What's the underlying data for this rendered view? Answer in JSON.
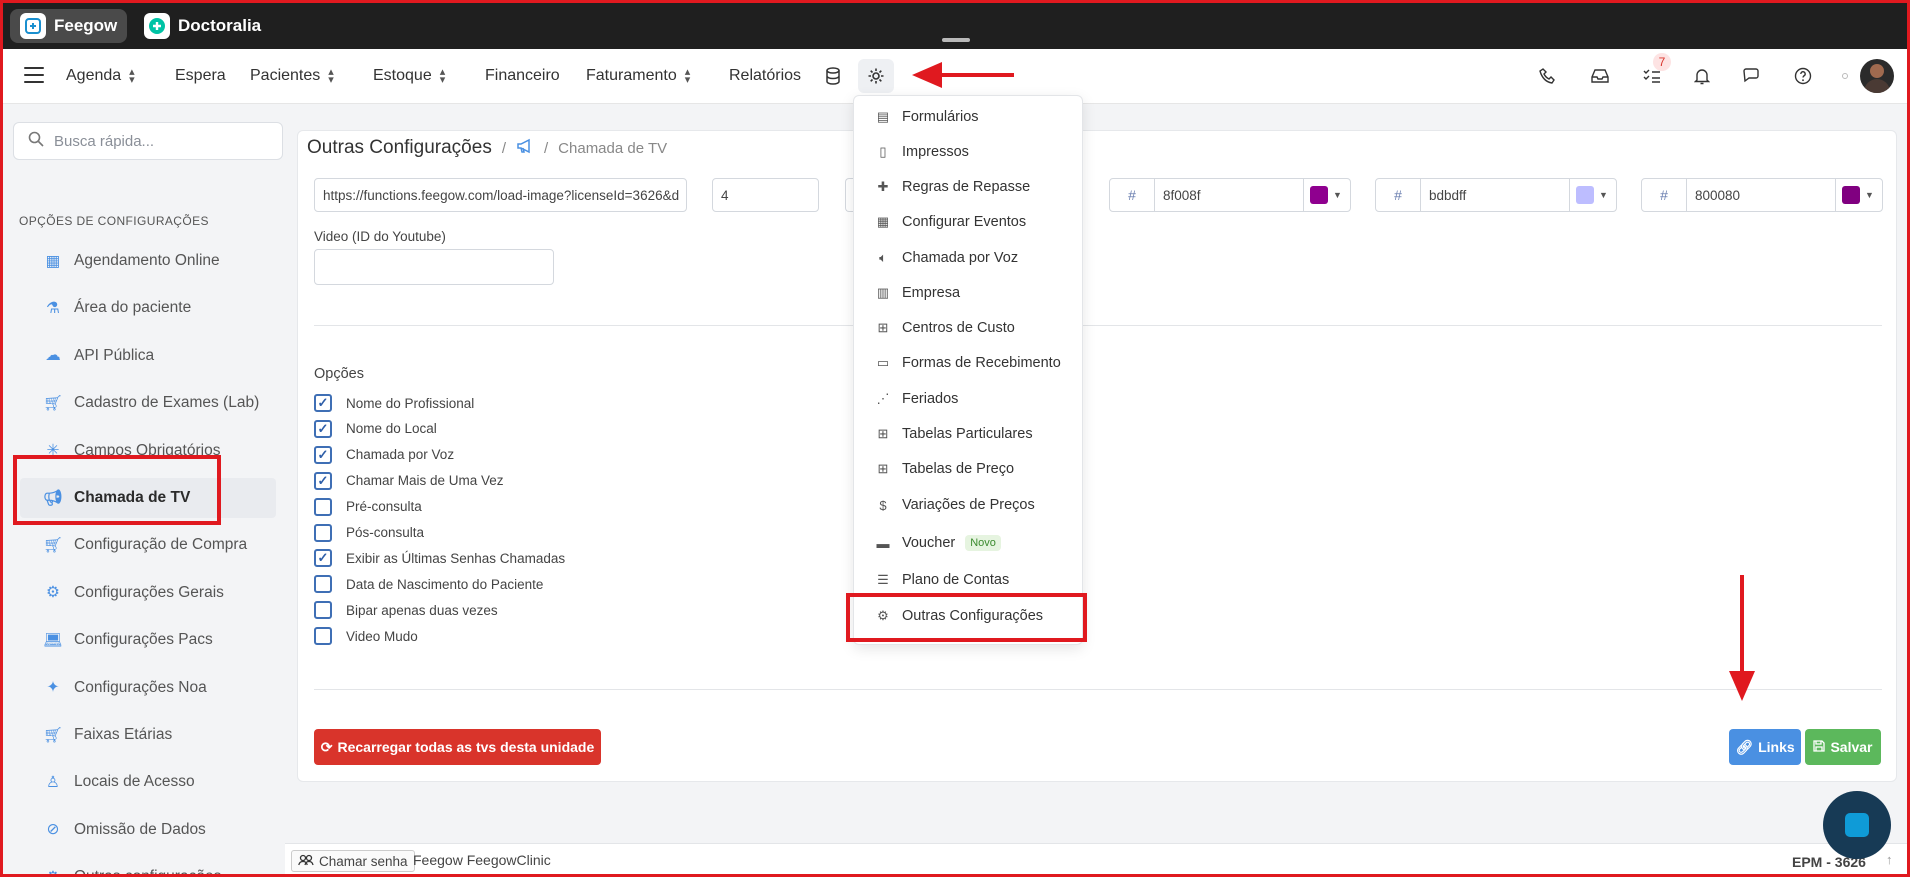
{
  "app_tabs": [
    {
      "label": "Feegow",
      "active": true
    },
    {
      "label": "Doctoralia",
      "active": false
    }
  ],
  "nav": {
    "items": [
      {
        "label": "Agenda"
      },
      {
        "label": "Espera"
      },
      {
        "label": "Pacientes"
      },
      {
        "label": "Estoque"
      },
      {
        "label": "Financeiro"
      },
      {
        "label": "Faturamento"
      },
      {
        "label": "Relatórios"
      }
    ],
    "tasks_badge": "7"
  },
  "sidebar": {
    "search_placeholder": "Busca rápida...",
    "section_title": "OPÇÕES DE CONFIGURAÇÕES",
    "items": [
      {
        "label": "Agendamento Online",
        "icon": "calendar-icon"
      },
      {
        "label": "Área do paciente",
        "icon": "flask-icon"
      },
      {
        "label": "API Pública",
        "icon": "cloud-upload-icon"
      },
      {
        "label": "Cadastro de Exames (Lab)",
        "icon": "cart-icon"
      },
      {
        "label": "Campos Obrigatórios",
        "icon": "asterisk-icon"
      },
      {
        "label": "Chamada de TV",
        "icon": "megaphone-icon",
        "active": true
      },
      {
        "label": "Configuração de Compra",
        "icon": "cart-icon"
      },
      {
        "label": "Configurações Gerais",
        "icon": "cogs-icon"
      },
      {
        "label": "Configurações Pacs",
        "icon": "laptop-icon"
      },
      {
        "label": "Configurações Noa",
        "icon": "sparkles-icon"
      },
      {
        "label": "Faixas Etárias",
        "icon": "cart-icon"
      },
      {
        "label": "Locais de Acesso",
        "icon": "user-lock-icon"
      },
      {
        "label": "Omissão de Dados",
        "icon": "eye-slash-icon"
      },
      {
        "label": "Outras configurações",
        "icon": "cogs-icon"
      }
    ]
  },
  "breadcrumb": {
    "title": "Outras Configurações",
    "separator": "/",
    "current": "Chamada de TV"
  },
  "form": {
    "image_url": "https://functions.feegow.com/load-image?licenseId=3626&d",
    "number_value": "4",
    "color1": "8f008f",
    "color2": "bdbdff",
    "color3": "800080",
    "hash_symbol": "#",
    "video_label": "Video (ID do Youtube)",
    "video_value": "",
    "options_label": "Opções",
    "options": [
      {
        "label": "Nome do Profissional",
        "checked": true
      },
      {
        "label": "Nome do Local",
        "checked": true
      },
      {
        "label": "Chamada por Voz",
        "checked": true
      },
      {
        "label": "Chamar Mais de Uma Vez",
        "checked": true
      },
      {
        "label": "Pré-consulta",
        "checked": false
      },
      {
        "label": "Pós-consulta",
        "checked": false
      },
      {
        "label": "Exibir as Últimas Senhas Chamadas",
        "checked": true
      },
      {
        "label": "Data de Nascimento do Paciente",
        "checked": false
      },
      {
        "label": "Bipar apenas duas vezes",
        "checked": false
      },
      {
        "label": "Video Mudo",
        "checked": false
      }
    ],
    "reload_button": "Recarregar todas as tvs desta unidade",
    "links_button": "Links",
    "save_button": "Salvar"
  },
  "settings_menu": {
    "items": [
      {
        "label": "Formulários",
        "icon": "chart-icon"
      },
      {
        "label": "Impressos",
        "icon": "file-icon"
      },
      {
        "label": "Regras de Repasse",
        "icon": "puzzle-icon"
      },
      {
        "label": "Configurar Eventos",
        "icon": "calendar-icon"
      },
      {
        "label": "Chamada por Voz",
        "icon": "volume-icon"
      },
      {
        "label": "Empresa",
        "icon": "building-icon"
      },
      {
        "label": "Centros de Custo",
        "icon": "sitemap-icon"
      },
      {
        "label": "Formas de Recebimento",
        "icon": "credit-card-icon"
      },
      {
        "label": "Feriados",
        "icon": "road-icon"
      },
      {
        "label": "Tabelas Particulares",
        "icon": "table-icon"
      },
      {
        "label": "Tabelas de Preço",
        "icon": "table-icon"
      },
      {
        "label": "Variações de Preços",
        "icon": "dollar-icon"
      },
      {
        "label": "Voucher",
        "icon": "ticket-icon",
        "badge": "Novo"
      },
      {
        "label": "Plano de Contas",
        "icon": "indent-icon"
      },
      {
        "label": "Outras Configurações",
        "icon": "cogs-icon"
      }
    ]
  },
  "footer": {
    "call_button": "Chamar senha",
    "brand": "Feegow FeegowClinic",
    "env": "EPM - 3626"
  },
  "colors": {
    "swatch1": "#8f008f",
    "swatch2": "#bdbdff",
    "swatch3": "#800080",
    "reload_red": "#d9342b",
    "links_blue": "#4a90e2",
    "save_green": "#5cb85c",
    "annotation_red": "#e0191f"
  }
}
